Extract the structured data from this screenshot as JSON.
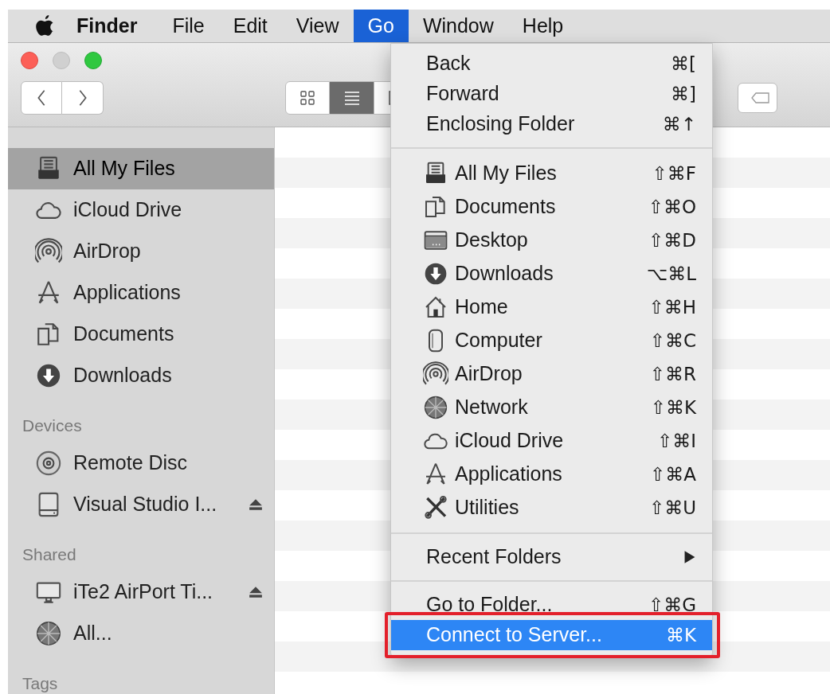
{
  "menu_bar": {
    "items": [
      {
        "label": "Finder",
        "kind": "app",
        "selected": false
      },
      {
        "label": "File",
        "kind": "menu",
        "selected": false
      },
      {
        "label": "Edit",
        "kind": "menu",
        "selected": false
      },
      {
        "label": "View",
        "kind": "menu",
        "selected": false
      },
      {
        "label": "Go",
        "kind": "menu",
        "selected": true
      },
      {
        "label": "Window",
        "kind": "menu",
        "selected": false
      },
      {
        "label": "Help",
        "kind": "menu",
        "selected": false
      }
    ]
  },
  "toolbar": {
    "view_modes": [
      {
        "selected": false
      },
      {
        "selected": true
      },
      {
        "selected": false
      }
    ]
  },
  "sidebar": {
    "sections": [
      {
        "items": [
          {
            "label": "All My Files",
            "selected": true,
            "eject": false
          },
          {
            "label": "iCloud Drive",
            "selected": false,
            "eject": false
          },
          {
            "label": "AirDrop",
            "selected": false,
            "eject": false
          },
          {
            "label": "Applications",
            "selected": false,
            "eject": false
          },
          {
            "label": "Documents",
            "selected": false,
            "eject": false
          },
          {
            "label": "Downloads",
            "selected": false,
            "eject": false
          }
        ]
      },
      {
        "heading": "Devices",
        "items": [
          {
            "label": "Remote Disc",
            "selected": false,
            "eject": false
          },
          {
            "label": "Visual Studio I...",
            "selected": false,
            "eject": true
          }
        ]
      },
      {
        "heading": "Shared",
        "items": [
          {
            "label": "iTe2 AirPort Ti...",
            "selected": false,
            "eject": true
          },
          {
            "label": "All...",
            "selected": false,
            "eject": false
          }
        ]
      },
      {
        "heading": "Tags"
      }
    ]
  },
  "go_menu": {
    "groups": [
      [
        {
          "label": "Back",
          "shortcut": "⌘[",
          "highlighted": false,
          "outlined": false,
          "submenu": false
        },
        {
          "label": "Forward",
          "shortcut": "⌘]",
          "highlighted": false,
          "outlined": false,
          "submenu": false
        },
        {
          "label": "Enclosing Folder",
          "shortcut": "⌘↑",
          "highlighted": false,
          "outlined": false,
          "submenu": false
        }
      ],
      [
        {
          "label": "All My Files",
          "shortcut": "⇧⌘F",
          "highlighted": false,
          "outlined": false,
          "submenu": false
        },
        {
          "label": "Documents",
          "shortcut": "⇧⌘O",
          "highlighted": false,
          "outlined": false,
          "submenu": false
        },
        {
          "label": "Desktop",
          "shortcut": "⇧⌘D",
          "highlighted": false,
          "outlined": false,
          "submenu": false
        },
        {
          "label": "Downloads",
          "shortcut": "⌥⌘L",
          "highlighted": false,
          "outlined": false,
          "submenu": false
        },
        {
          "label": "Home",
          "shortcut": "⇧⌘H",
          "highlighted": false,
          "outlined": false,
          "submenu": false
        },
        {
          "label": "Computer",
          "shortcut": "⇧⌘C",
          "highlighted": false,
          "outlined": false,
          "submenu": false
        },
        {
          "label": "AirDrop",
          "shortcut": "⇧⌘R",
          "highlighted": false,
          "outlined": false,
          "submenu": false
        },
        {
          "label": "Network",
          "shortcut": "⇧⌘K",
          "highlighted": false,
          "outlined": false,
          "submenu": false
        },
        {
          "label": "iCloud Drive",
          "shortcut": "⇧⌘I",
          "highlighted": false,
          "outlined": false,
          "submenu": false
        },
        {
          "label": "Applications",
          "shortcut": "⇧⌘A",
          "highlighted": false,
          "outlined": false,
          "submenu": false
        },
        {
          "label": "Utilities",
          "shortcut": "⇧⌘U",
          "highlighted": false,
          "outlined": false,
          "submenu": false
        }
      ],
      [
        {
          "label": "Recent Folders",
          "highlighted": false,
          "outlined": false,
          "submenu": true
        }
      ],
      [
        {
          "label": "Go to Folder...",
          "shortcut": "⇧⌘G",
          "highlighted": false,
          "outlined": false,
          "submenu": false
        },
        {
          "label": "Connect to Server...",
          "shortcut": "⌘K",
          "highlighted": true,
          "outlined": true,
          "submenu": false
        }
      ]
    ]
  }
}
